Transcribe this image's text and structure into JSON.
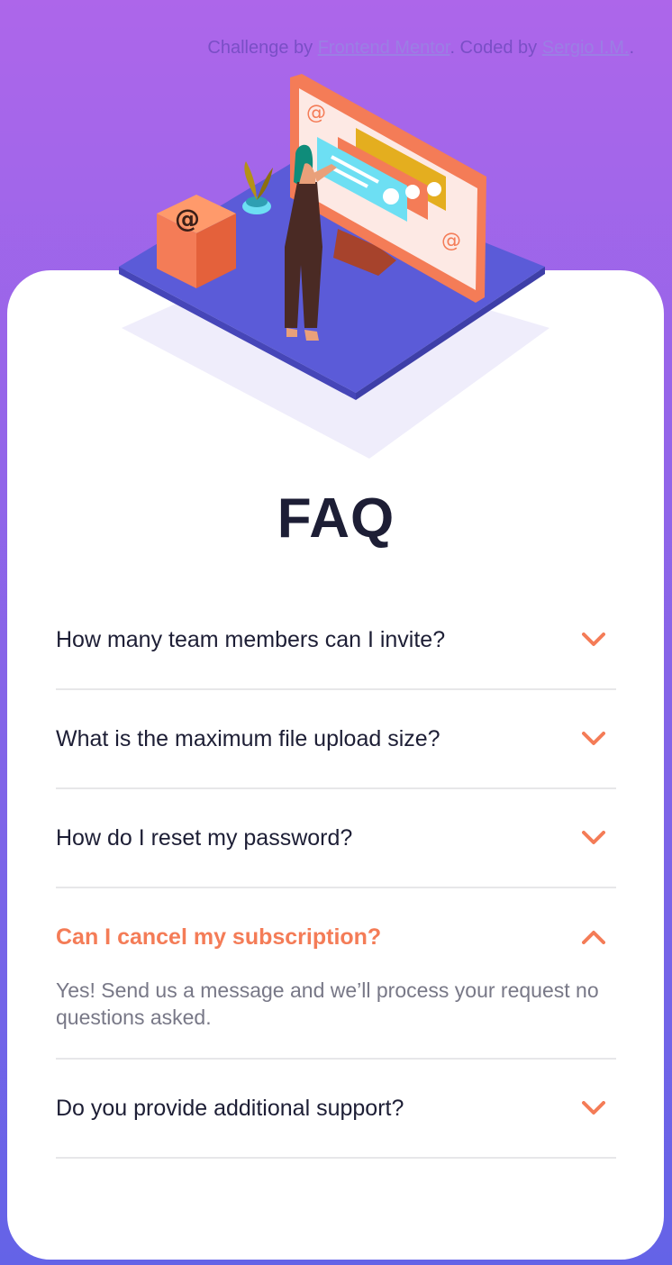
{
  "attribution": {
    "prefix": "Challenge by ",
    "challenge_link": "Frontend Mentor",
    "middle": ". Coded by ",
    "author_link": "Sergio I.M.",
    "suffix": "."
  },
  "header": {
    "title": "FAQ"
  },
  "faq": {
    "items": [
      {
        "question": "How many team members can I invite?",
        "answer": "",
        "open": false
      },
      {
        "question": "What is the maximum file upload size?",
        "answer": "",
        "open": false
      },
      {
        "question": "How do I reset my password?",
        "answer": "",
        "open": false
      },
      {
        "question": "Can I cancel my subscription?",
        "answer": "Yes! Send us a message and we’ll process your request no questions asked.",
        "open": true
      },
      {
        "question": "Do you provide additional support?",
        "answer": "",
        "open": false
      }
    ]
  },
  "colors": {
    "accent": "#f47c57",
    "title": "#1d1e35",
    "gradient_top": "#ad66ea",
    "gradient_bottom": "#6463e7"
  },
  "icons": {
    "collapsed": "chevron-down-icon",
    "expanded": "chevron-up-icon"
  }
}
